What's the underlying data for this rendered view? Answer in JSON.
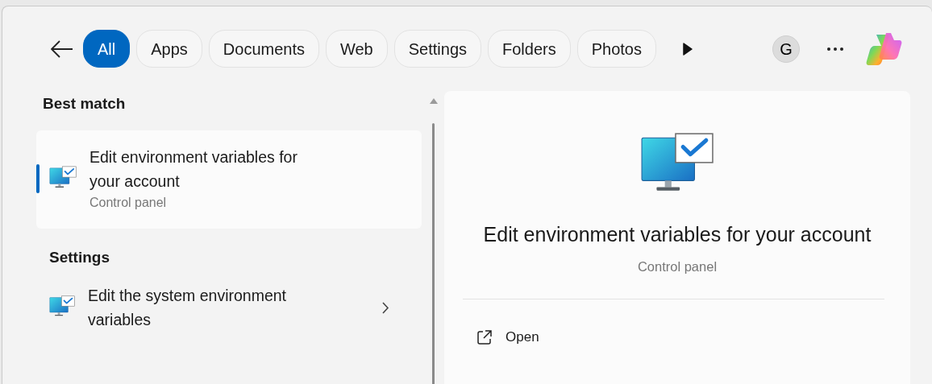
{
  "filters": [
    {
      "label": "All",
      "selected": true
    },
    {
      "label": "Apps",
      "selected": false
    },
    {
      "label": "Documents",
      "selected": false
    },
    {
      "label": "Web",
      "selected": false
    },
    {
      "label": "Settings",
      "selected": false
    },
    {
      "label": "Folders",
      "selected": false
    },
    {
      "label": "Photos",
      "selected": false
    }
  ],
  "profile_initial": "G",
  "best_match": {
    "heading": "Best match",
    "title": "Edit environment variables for your account",
    "subtitle": "Control panel",
    "selected": true
  },
  "settings": {
    "heading": "Settings",
    "items": [
      {
        "title": "Edit the system environment variables"
      }
    ]
  },
  "preview": {
    "title": "Edit environment variables for your account",
    "subtitle": "Control panel",
    "actions": [
      {
        "label": "Open"
      }
    ]
  }
}
